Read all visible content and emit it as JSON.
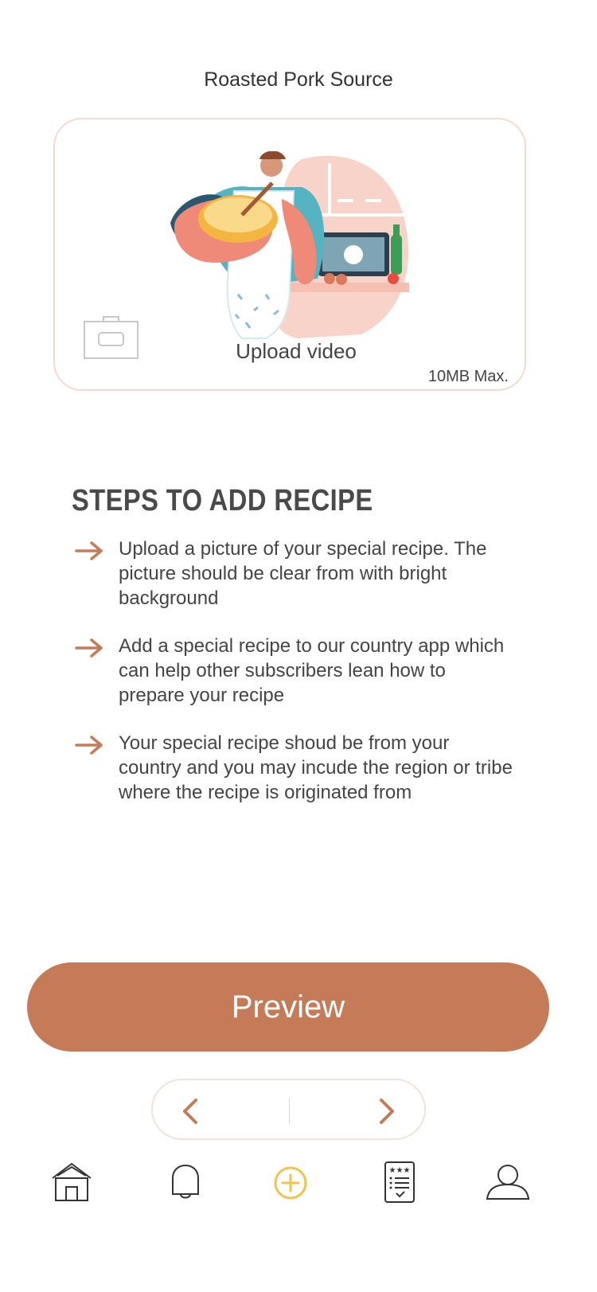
{
  "header": {
    "title": "Roasted Pork Source"
  },
  "upload": {
    "label": "Upload video",
    "size_note": "10MB Max."
  },
  "steps": {
    "heading": "STEPS TO ADD RECIPE",
    "items": [
      {
        "text": "Upload a picture of your special recipe. The picture should be clear from with bright background"
      },
      {
        "text": "Add a special recipe to our country app which can help other subscribers lean how to prepare your recipe"
      },
      {
        "text": "Your special recipe shoud be from your country and you may incude the region or tribe where the recipe is originated from"
      }
    ]
  },
  "actions": {
    "preview_label": "Preview"
  },
  "tabs": [
    {
      "icon": "home-icon"
    },
    {
      "icon": "bell-icon"
    },
    {
      "icon": "add-icon",
      "active": true
    },
    {
      "icon": "recipe-list-icon"
    },
    {
      "icon": "profile-icon"
    }
  ],
  "colors": {
    "accent": "#c57b58",
    "active_tab": "#f2c14e",
    "card_border": "#f0dcd3"
  }
}
